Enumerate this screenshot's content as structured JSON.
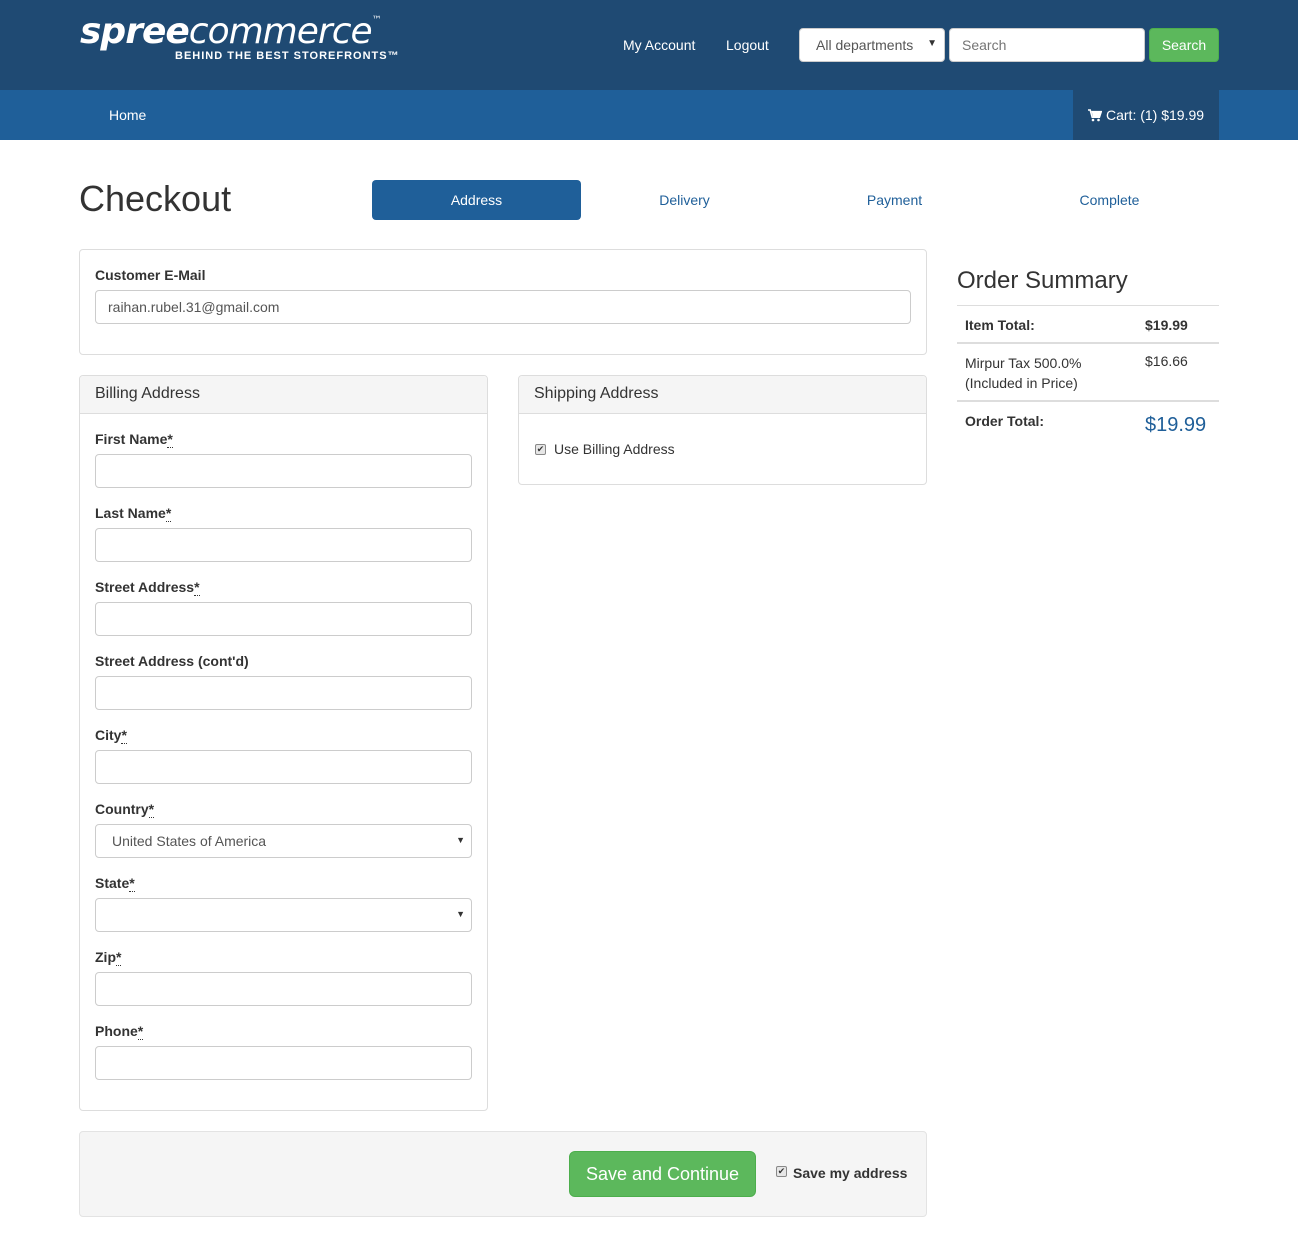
{
  "header": {
    "logo_main_bold": "spree",
    "logo_main_thin": "commerce",
    "logo_tm": "™",
    "logo_tagline": "BEHIND THE BEST STOREFRONTS™",
    "my_account": "My Account",
    "logout": "Logout",
    "department_selected": "All departments",
    "search_placeholder": "Search",
    "search_button": "Search"
  },
  "nav": {
    "home": "Home",
    "cart": "Cart: (1) $19.99"
  },
  "checkout": {
    "title": "Checkout",
    "steps": [
      "Address",
      "Delivery",
      "Payment",
      "Complete"
    ],
    "active_step": "Address"
  },
  "email_panel": {
    "label": "Customer E-Mail",
    "value": "raihan.rubel.31@gmail.com"
  },
  "billing": {
    "heading": "Billing Address",
    "first_name": "First Name",
    "last_name": "Last Name",
    "street": "Street Address",
    "street2": "Street Address (cont'd)",
    "city": "City",
    "country": "Country",
    "country_value": "United States of America",
    "state": "State",
    "zip": "Zip",
    "phone": "Phone",
    "required_mark": "*"
  },
  "shipping": {
    "heading": "Shipping Address",
    "use_billing_label": "Use Billing Address",
    "use_billing_checked": true
  },
  "summary": {
    "title": "Order Summary",
    "item_total_label": "Item Total:",
    "item_total_value": "$19.99",
    "tax_label_1": "Mirpur Tax 500.0%",
    "tax_label_2": "(Included in Price)",
    "tax_value": "$16.66",
    "order_total_label": "Order Total:",
    "order_total_value": "$19.99"
  },
  "actions": {
    "save_continue": "Save and Continue",
    "save_address_label": "Save my address",
    "save_address_checked": true
  },
  "colors": {
    "header_bg": "#1f4a73",
    "nav_bg": "#1f5f99",
    "accent_green": "#5cb85c",
    "link_blue": "#1f5f99"
  }
}
